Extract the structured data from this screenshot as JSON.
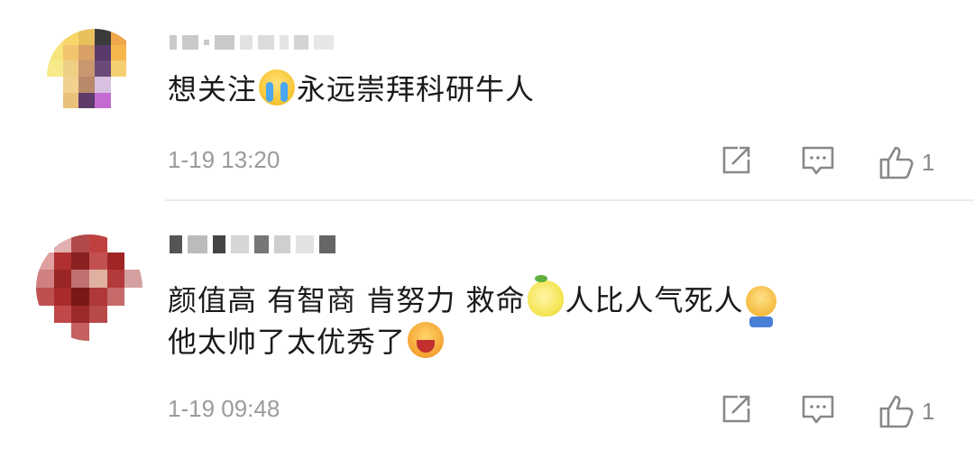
{
  "comments": [
    {
      "text_before": "想关注",
      "emoji1": "cry-emoji",
      "text_after": "永远崇拜科研牛人",
      "time": "1-19 13:20",
      "like_count": "1",
      "avatar_colors": [
        "#f4e08a",
        "#f7d76b",
        "#e8c15c",
        "#3a3a3a",
        "#efa54a",
        "#ffffff",
        "#f6e57a",
        "#f2c46e",
        "#d8a067",
        "#5a3a6a",
        "#f7b64c",
        "#ffffff",
        "#f6ea8a",
        "#efcf86",
        "#c8966f",
        "#6b4a7a",
        "#f5d072",
        "#ffffff",
        "#ffffff",
        "#f2d090",
        "#b88a6a",
        "#d7c0e0",
        "#ffffff",
        "#ffffff",
        "#ffffff",
        "#e8c27a",
        "#5e3a6a",
        "#c56ad1",
        "#ffffff",
        "#ffffff",
        "#ffffff",
        "#ffffff",
        "#ffffff",
        "#ffffff",
        "#ffffff",
        "#ffffff"
      ]
    },
    {
      "line1_a": "颜值高 有智商 肯努力 救命",
      "line1_b": "人比人气死人",
      "line2": "他太帅了太优秀了",
      "time": "1-19 09:48",
      "like_count": "1",
      "avatar_colors": [
        "#ffffff",
        "#e2b0b0",
        "#b14a4a",
        "#c04040",
        "#ffffff",
        "#ffffff",
        "#e0a0a0",
        "#b03030",
        "#8a2020",
        "#c35050",
        "#a02525",
        "#ffffff",
        "#d08080",
        "#9a2525",
        "#c07070",
        "#e0b0a0",
        "#b33a3a",
        "#d4a0a0",
        "#c05050",
        "#a82a2a",
        "#7a1818",
        "#b03838",
        "#c76a6a",
        "#ffffff",
        "#ffffff",
        "#c04848",
        "#9c2a2a",
        "#b94a4a",
        "#ffffff",
        "#ffffff",
        "#ffffff",
        "#ffffff",
        "#c46060",
        "#ffffff",
        "#ffffff",
        "#ffffff"
      ]
    }
  ]
}
